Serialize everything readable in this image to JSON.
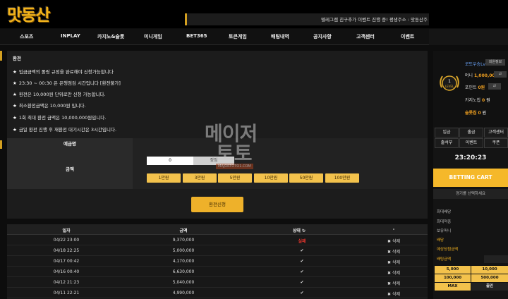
{
  "header": {
    "logo": "맛동산",
    "ticker": "텔레그램 친구추가 이벤트 진행 중! 평생주소 : 맛동산주"
  },
  "nav": [
    "스포츠",
    "INPLAY",
    "카지노&슬롯",
    "미니게임",
    "BET365",
    "토큰게임",
    "배팅내역",
    "공지사항",
    "고객센터",
    "이벤트"
  ],
  "exchange": {
    "title": "환전",
    "rules": [
      "입금금액의 롤링 규정을 완료해야 신청가능합니다",
      "23:30 ~ 00:30 은 은행점검 시간입니다 [환전불가]",
      "환전은 10,000원 단위로만 신청 가능합니다.",
      "최소환전금액은 10,000원 입니다.",
      "1회 최대 환전 금액은 10,000,000원입니다.",
      "금일 환전 진행 후 재환전 대기시간은 3시간입니다."
    ],
    "holder_label": "예금명",
    "amount_label": "금액",
    "amount_value": "0",
    "clear_label": "정정",
    "quick_amounts": [
      "1만원",
      "3만원",
      "5만원",
      "10만원",
      "50만원",
      "100만원"
    ],
    "submit_label": "환전신청"
  },
  "history": {
    "headers": [
      "일자",
      "금액",
      "상태",
      "-"
    ],
    "rows": [
      {
        "date": "04/22 23:00",
        "amount": "9,370,000",
        "status": "실패",
        "action": "삭제"
      },
      {
        "date": "04/18 22:25",
        "amount": "5,000,000",
        "status": "✔",
        "action": "삭제"
      },
      {
        "date": "04/17 00:42",
        "amount": "4,170,000",
        "status": "✔",
        "action": "삭제"
      },
      {
        "date": "04/16 00:40",
        "amount": "6,630,000",
        "status": "✔",
        "action": "삭제"
      },
      {
        "date": "04/12 21:23",
        "amount": "5,040,000",
        "status": "✔",
        "action": "삭제"
      },
      {
        "date": "04/11 22:21",
        "amount": "4,990,000",
        "status": "✔",
        "action": "삭제"
      }
    ]
  },
  "sidebar": {
    "username": "로또우승Lv",
    "member_info": "회원정보",
    "level_text": "LEVEL",
    "level_num": "1",
    "money_label": "머니",
    "money_value": "1,000,000",
    "money_unit": "원",
    "point_label": "포인트",
    "point_value": "0원",
    "casino_label": "카지노칩",
    "casino_value": "0",
    "casino_unit": "원",
    "slot_label": "슬롯칩",
    "slot_value": "0",
    "slot_unit": "원",
    "grid_buttons": [
      "입금",
      "출금",
      "고객센터",
      "출석부",
      "이벤트",
      "쿠폰"
    ],
    "clock": "23:20:23",
    "cart_label": "BETTING CART",
    "cart_note": "경기를 선택하세요",
    "lines": [
      "최대배당",
      "최대적중",
      "보유머니",
      "배당",
      "예상당첨금액",
      "배팅금액"
    ],
    "chips": [
      "5,000",
      "10,000",
      "100,000",
      "500,000",
      "MAX",
      "출인"
    ]
  },
  "watermark": {
    "line1": "메이저",
    "line2": "토토",
    "url": "MAJORTOTO1.COM"
  },
  "colors": {
    "accent": "#f3c24c",
    "fail": "#e0342c",
    "link": "#6ea8ff"
  }
}
